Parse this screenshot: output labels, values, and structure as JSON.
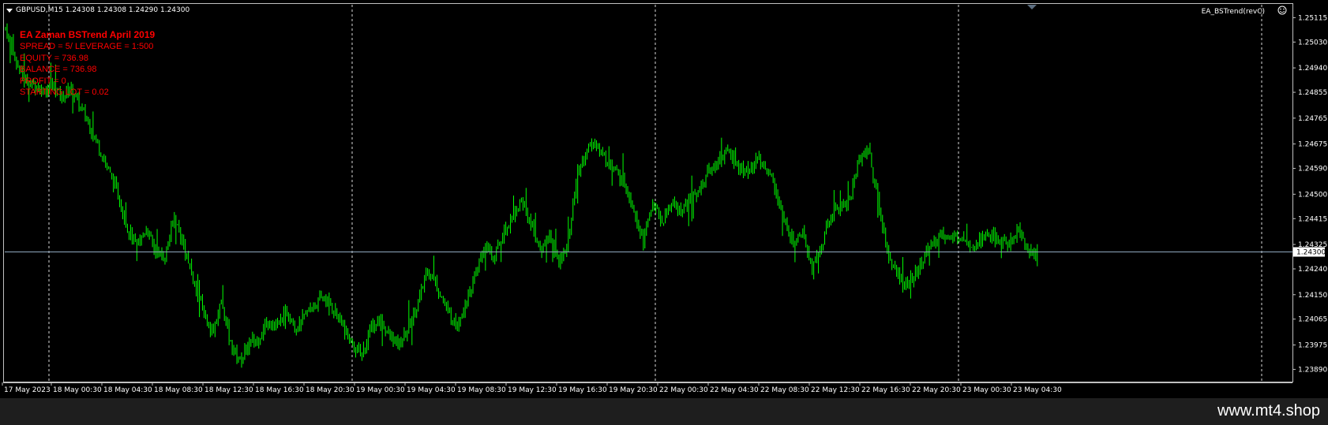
{
  "header": {
    "symbol_line": "GBPUSD,M15  1.24308 1.24308 1.24290 1.24300",
    "indicator_name": "EA_BSTrend(revC)"
  },
  "ea_info": {
    "title": "EA Zaman BSTrend April 2019",
    "lines": [
      "SPREAD = 5/ LEVERAGE = 1:500",
      "EQUITY = 736.98",
      "BALANCE = 736.98",
      "PROFIT = 0",
      "STARTING LOT = 0.02"
    ]
  },
  "footer": {
    "url": "www.mt4.shop"
  },
  "colors": {
    "background": "#000000",
    "candle": "#00ff00",
    "grid": "#ffffff",
    "ask_line": "#8fa8c0",
    "ea_text": "#ff0000"
  },
  "chart_data": {
    "type": "candlestick",
    "symbol": "GBPUSD",
    "timeframe": "M15",
    "ohlc_current": {
      "open": 1.24308,
      "high": 1.24308,
      "low": 1.2429,
      "close": 1.243
    },
    "current_price_label": "1.24300",
    "current_price": 1.243,
    "ylim": [
      1.2385,
      1.2516
    ],
    "y_ticks": [
      "1.25115",
      "1.25030",
      "1.24940",
      "1.24855",
      "1.24765",
      "1.24675",
      "1.24590",
      "1.24500",
      "1.24415",
      "1.24325",
      "1.24240",
      "1.24150",
      "1.24065",
      "1.23975",
      "1.23890"
    ],
    "x_labels": [
      "17 May 2023",
      "18 May 00:30",
      "18 May 04:30",
      "18 May 08:30",
      "18 May 12:30",
      "18 May 16:30",
      "18 May 20:30",
      "19 May 00:30",
      "19 May 04:30",
      "19 May 08:30",
      "19 May 12:30",
      "19 May 16:30",
      "19 May 20:30",
      "22 May 00:30",
      "22 May 04:30",
      "22 May 08:30",
      "22 May 12:30",
      "22 May 16:30",
      "22 May 20:30",
      "23 May 00:30",
      "23 May 04:30"
    ],
    "period_separators": [
      "18 May",
      "19 May",
      "20 May",
      "22 May",
      "23 May"
    ],
    "close_path": [
      [
        0,
        1.2508
      ],
      [
        6,
        1.2497
      ],
      [
        12,
        1.249
      ],
      [
        18,
        1.2488
      ],
      [
        24,
        1.2486
      ],
      [
        30,
        1.2488
      ],
      [
        36,
        1.2484
      ],
      [
        42,
        1.2487
      ],
      [
        48,
        1.248
      ],
      [
        54,
        1.2474
      ],
      [
        60,
        1.2466
      ],
      [
        66,
        1.2458
      ],
      [
        72,
        1.245
      ],
      [
        78,
        1.2438
      ],
      [
        84,
        1.2432
      ],
      [
        90,
        1.2438
      ],
      [
        96,
        1.243
      ],
      [
        102,
        1.2428
      ],
      [
        108,
        1.2442
      ],
      [
        114,
        1.2432
      ],
      [
        120,
        1.242
      ],
      [
        126,
        1.241
      ],
      [
        132,
        1.2402
      ],
      [
        138,
        1.2412
      ],
      [
        144,
        1.2398
      ],
      [
        150,
        1.2392
      ],
      [
        156,
        1.2398
      ],
      [
        162,
        1.24
      ],
      [
        168,
        1.2406
      ],
      [
        174,
        1.2404
      ],
      [
        180,
        1.241
      ],
      [
        186,
        1.2403
      ],
      [
        192,
        1.2408
      ],
      [
        198,
        1.2412
      ],
      [
        204,
        1.2414
      ],
      [
        210,
        1.241
      ],
      [
        216,
        1.2404
      ],
      [
        222,
        1.2397
      ],
      [
        228,
        1.2394
      ],
      [
        234,
        1.2404
      ],
      [
        240,
        1.2406
      ],
      [
        246,
        1.24
      ],
      [
        252,
        1.2397
      ],
      [
        258,
        1.2404
      ],
      [
        264,
        1.2412
      ],
      [
        270,
        1.2424
      ],
      [
        276,
        1.2418
      ],
      [
        282,
        1.241
      ],
      [
        288,
        1.2404
      ],
      [
        294,
        1.2412
      ],
      [
        300,
        1.242
      ],
      [
        306,
        1.2432
      ],
      [
        312,
        1.2428
      ],
      [
        318,
        1.2436
      ],
      [
        324,
        1.2442
      ],
      [
        330,
        1.2448
      ],
      [
        336,
        1.244
      ],
      [
        342,
        1.243
      ],
      [
        348,
        1.2436
      ],
      [
        354,
        1.2426
      ],
      [
        360,
        1.2434
      ],
      [
        366,
        1.2458
      ],
      [
        372,
        1.2465
      ],
      [
        378,
        1.2468
      ],
      [
        384,
        1.2462
      ],
      [
        390,
        1.2458
      ],
      [
        396,
        1.2454
      ],
      [
        402,
        1.2445
      ],
      [
        408,
        1.2434
      ],
      [
        414,
        1.2447
      ],
      [
        420,
        1.244
      ],
      [
        426,
        1.2447
      ],
      [
        432,
        1.2444
      ],
      [
        438,
        1.2448
      ],
      [
        444,
        1.2452
      ],
      [
        450,
        1.2458
      ],
      [
        456,
        1.2462
      ],
      [
        462,
        1.2465
      ],
      [
        468,
        1.246
      ],
      [
        474,
        1.2458
      ],
      [
        480,
        1.2462
      ],
      [
        486,
        1.246
      ],
      [
        492,
        1.2453
      ],
      [
        498,
        1.244
      ],
      [
        504,
        1.2434
      ],
      [
        510,
        1.2438
      ],
      [
        516,
        1.2424
      ],
      [
        522,
        1.2432
      ],
      [
        528,
        1.2442
      ],
      [
        534,
        1.2446
      ],
      [
        540,
        1.2448
      ],
      [
        546,
        1.2462
      ],
      [
        552,
        1.2466
      ],
      [
        558,
        1.2448
      ],
      [
        564,
        1.243
      ],
      [
        570,
        1.2422
      ],
      [
        576,
        1.2418
      ],
      [
        582,
        1.2422
      ],
      [
        588,
        1.2428
      ],
      [
        594,
        1.2434
      ],
      [
        600,
        1.2436
      ],
      [
        606,
        1.2434
      ],
      [
        612,
        1.2436
      ],
      [
        618,
        1.2432
      ],
      [
        624,
        1.2434
      ],
      [
        630,
        1.2436
      ],
      [
        636,
        1.2434
      ],
      [
        642,
        1.2433
      ],
      [
        648,
        1.2438
      ],
      [
        654,
        1.243
      ],
      [
        660,
        1.243
      ]
    ],
    "grid": false,
    "legend": "none"
  }
}
